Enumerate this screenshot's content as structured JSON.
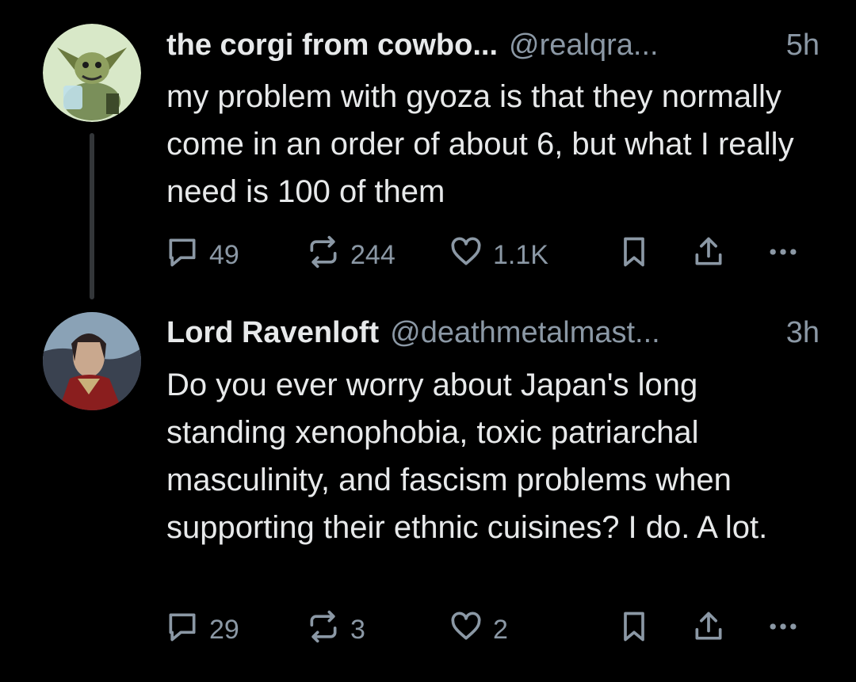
{
  "tweets": [
    {
      "display_name": "the corgi from cowbo...",
      "handle": "@realqra...",
      "time": "5h",
      "text": "my problem with gyoza is that they normally come in an order of about 6, but what I really need is 100 of them",
      "replies": "49",
      "retweets": "244",
      "likes": "1.1K"
    },
    {
      "display_name": "Lord Ravenloft",
      "handle": "@deathmetalmast...",
      "time": "3h",
      "text": "Do you ever worry about Japan's long standing xenophobia, toxic patriarchal masculinity, and fascism problems when supporting their ethnic cuisines? I do. A lot.",
      "replies": "29",
      "retweets": "3",
      "likes": "2"
    }
  ],
  "icons": {
    "reply": "speech-bubble-icon",
    "retweet": "retweet-arrows-icon",
    "like": "heart-icon",
    "bookmark": "bookmark-icon",
    "share": "share-upload-icon",
    "more": "ellipsis-icon"
  },
  "colors": {
    "background": "#000000",
    "text": "#e7e9ea",
    "muted": "#8b98a5",
    "thread_line": "#333639"
  }
}
